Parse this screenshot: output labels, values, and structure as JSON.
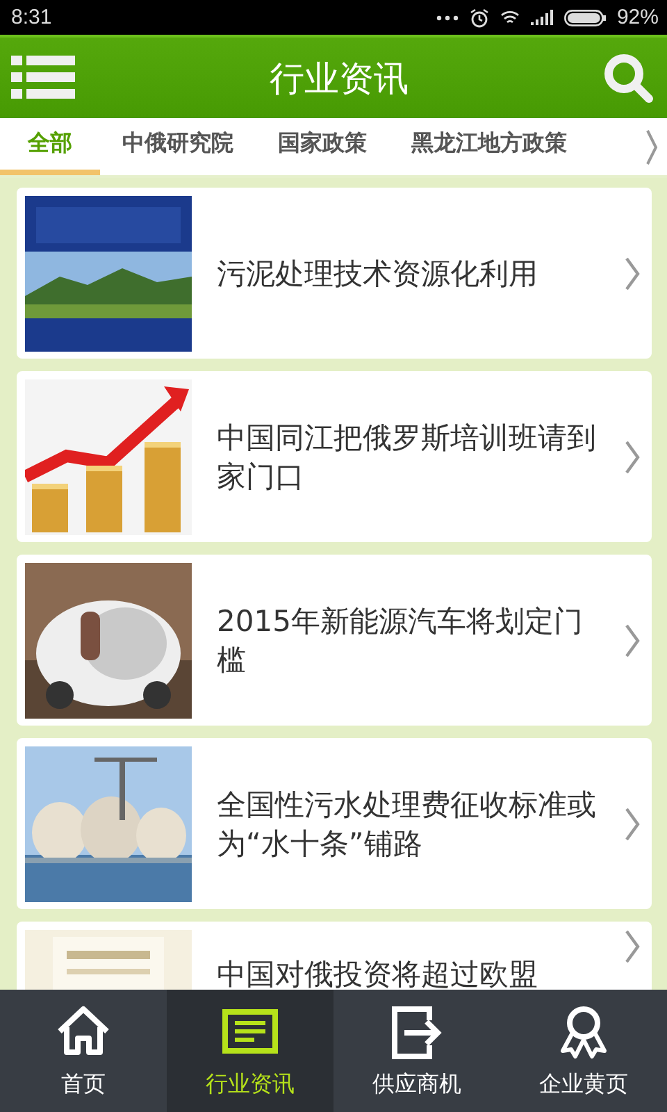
{
  "status_bar": {
    "time": "8:31",
    "battery": "92%"
  },
  "header": {
    "title": "行业资讯"
  },
  "tabs": [
    {
      "label": "全部",
      "selected": true
    },
    {
      "label": "中俄研究院",
      "selected": false
    },
    {
      "label": "国家政策",
      "selected": false
    },
    {
      "label": "黑龙江地方政策",
      "selected": false
    }
  ],
  "articles": [
    {
      "title": "污泥处理技术资源化利用"
    },
    {
      "title": "中国同江把俄罗斯培训班请到家门口"
    },
    {
      "title": "2015年新能源汽车将划定门槛"
    },
    {
      "title": "全国性污水处理费征收标准或为“水十条”铺路"
    },
    {
      "title": "中国对俄投资将超过欧盟"
    }
  ],
  "bottom_nav": [
    {
      "label": "首页",
      "selected": false
    },
    {
      "label": "行业资讯",
      "selected": true
    },
    {
      "label": "供应商机",
      "selected": false
    },
    {
      "label": "企业黄页",
      "selected": false
    }
  ]
}
